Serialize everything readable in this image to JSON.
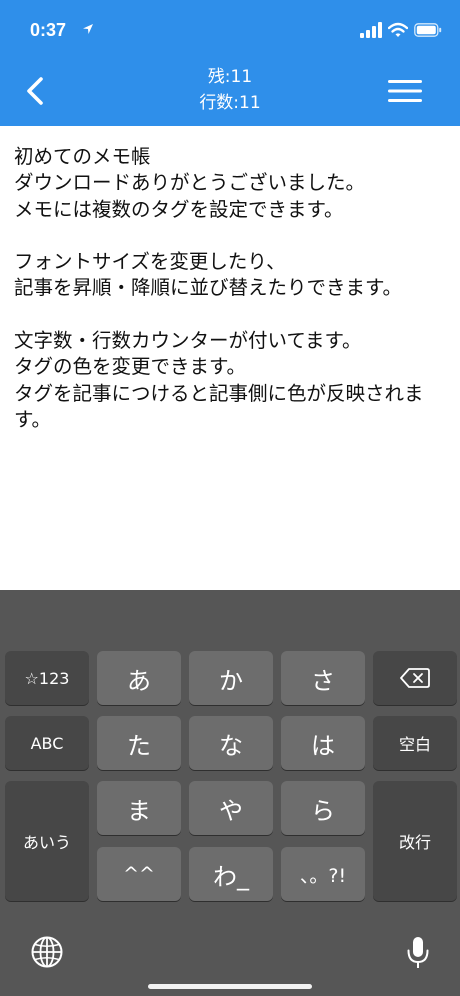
{
  "status_bar": {
    "time": "0:37",
    "icons": [
      "location-arrow-icon",
      "signal-bars-icon",
      "wifi-icon",
      "battery-icon"
    ]
  },
  "nav": {
    "remaining": "残:11",
    "lines": "行数:11",
    "back_icon": "chevron-left-icon",
    "menu_icon": "hamburger-menu-icon"
  },
  "note": {
    "text": "初めてのメモ帳\nダウンロードありがとうございました。\nメモには複数のタグを設定できます。\n\nフォントサイズを変更したり、\n記事を昇順・降順に並び替えたりできます。\n\n文字数・行数カウンターが付いてます。\nタグの色を変更できます。\nタグを記事につけると記事側に色が反映されます。"
  },
  "keyboard": {
    "numbers_key": "☆123",
    "abc_key": "ABC",
    "kana_mode_key": "あいう",
    "row1": [
      "あ",
      "か",
      "さ"
    ],
    "row2": [
      "た",
      "な",
      "は"
    ],
    "row3": [
      "ま",
      "や",
      "ら"
    ],
    "row4": [
      "^^",
      "わ_",
      "、。?!"
    ],
    "space_key": "空白",
    "return_key": "改行",
    "icons": [
      "backspace-icon",
      "globe-icon",
      "microphone-icon"
    ]
  },
  "colors": {
    "header": "#2f8fea",
    "keyboard_bg": "#565656",
    "key_light": "#6d6d6d",
    "key_dark": "#474747"
  }
}
